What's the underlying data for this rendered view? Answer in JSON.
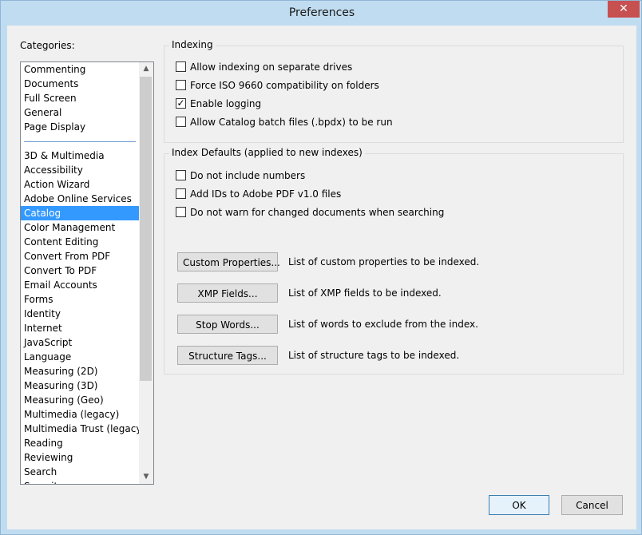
{
  "window": {
    "title": "Preferences",
    "close_glyph": "✕"
  },
  "categories": {
    "label": "Categories:",
    "group1": [
      "Commenting",
      "Documents",
      "Full Screen",
      "General",
      "Page Display"
    ],
    "group2": [
      "3D & Multimedia",
      "Accessibility",
      "Action Wizard",
      "Adobe Online Services",
      "Catalog",
      "Color Management",
      "Content Editing",
      "Convert From PDF",
      "Convert To PDF",
      "Email Accounts",
      "Forms",
      "Identity",
      "Internet",
      "JavaScript",
      "Language",
      "Measuring (2D)",
      "Measuring (3D)",
      "Measuring (Geo)",
      "Multimedia (legacy)",
      "Multimedia Trust (legacy)",
      "Reading",
      "Reviewing",
      "Search",
      "Security"
    ],
    "selected": "Catalog",
    "scroll_up_glyph": "▲",
    "scroll_down_glyph": "▼"
  },
  "indexing": {
    "title": "Indexing",
    "options": [
      {
        "label": "Allow indexing on separate drives",
        "checked": false
      },
      {
        "label": "Force ISO 9660 compatibility on folders",
        "checked": false
      },
      {
        "label": "Enable logging",
        "checked": true
      },
      {
        "label": "Allow Catalog batch files (.bpdx) to be run",
        "checked": false
      }
    ]
  },
  "index_defaults": {
    "title": "Index Defaults (applied to new indexes)",
    "options": [
      {
        "label": "Do not include numbers",
        "checked": false
      },
      {
        "label": "Add IDs to Adobe PDF v1.0 files",
        "checked": false
      },
      {
        "label": "Do not warn for changed documents when searching",
        "checked": false
      }
    ],
    "buttons": [
      {
        "label": "Custom Properties...",
        "desc": "List of custom properties to be indexed."
      },
      {
        "label": "XMP Fields...",
        "desc": "List of XMP fields to be indexed."
      },
      {
        "label": "Stop Words...",
        "desc": "List of words to exclude from the index."
      },
      {
        "label": "Structure Tags...",
        "desc": "List of structure tags to be indexed."
      }
    ]
  },
  "footer": {
    "ok_label": "OK",
    "cancel_label": "Cancel"
  },
  "colors": {
    "selection": "#3399ff",
    "title_bar": "#c0dcf0",
    "close_button": "#c75050"
  }
}
